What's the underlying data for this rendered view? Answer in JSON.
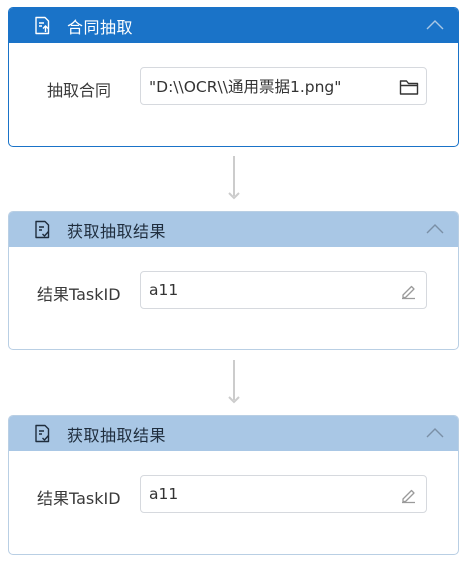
{
  "cards": [
    {
      "title": "合同抽取",
      "icon": "document-upload-icon",
      "field_label": "抽取合同",
      "field_value": "\"D:\\\\OCR\\\\通用票据1.png\"",
      "field_button_icon": "folder-icon"
    },
    {
      "title": "获取抽取结果",
      "icon": "document-check-icon",
      "field_label": "结果TaskID",
      "field_value": "a11",
      "field_button_icon": "pencil-icon"
    },
    {
      "title": "获取抽取结果",
      "icon": "document-check-icon",
      "field_label": "结果TaskID",
      "field_value": "a11",
      "field_button_icon": "pencil-icon"
    }
  ],
  "colors": {
    "active_header": "#1a73c8",
    "inactive_header": "#a9c7e5",
    "connector": "#cccccc"
  }
}
